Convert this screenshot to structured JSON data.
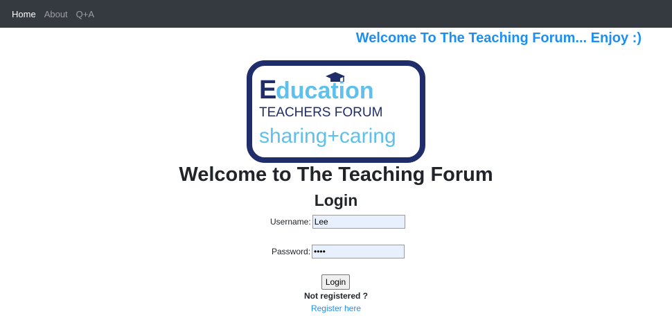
{
  "nav": {
    "items": [
      {
        "label": "Home"
      },
      {
        "label": "About"
      },
      {
        "label": "Q+A"
      }
    ]
  },
  "banner": {
    "text": "Welcome To The Teaching Forum... Enjoy :)"
  },
  "logo": {
    "line1_letter": "E",
    "line1_rest": "ducation",
    "line2": "TEACHERS FORUM",
    "line3": "sharing+caring",
    "colors": {
      "navy": "#1f2d6b",
      "sky": "#5ec0ec"
    }
  },
  "main": {
    "title": "Welcome to The Teaching Forum",
    "login_heading": "Login"
  },
  "form": {
    "username_label": "Username:",
    "username_value": "Lee",
    "password_label": "Password:",
    "password_value": "abcd",
    "submit_label": "Login"
  },
  "footer": {
    "not_registered": "Not registered ?",
    "register_link": "Register here"
  },
  "colors": {
    "navbar": "#343a40",
    "accent": "#1e8ff0"
  }
}
